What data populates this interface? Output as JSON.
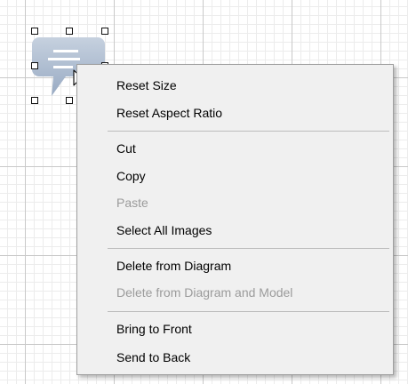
{
  "menu": {
    "items": [
      {
        "label": "Reset Size",
        "enabled": true
      },
      {
        "label": "Reset Aspect Ratio",
        "enabled": true
      },
      {
        "label": "Cut",
        "enabled": true
      },
      {
        "label": "Copy",
        "enabled": true
      },
      {
        "label": "Paste",
        "enabled": false
      },
      {
        "label": "Select All Images",
        "enabled": true
      },
      {
        "label": "Delete from Diagram",
        "enabled": true
      },
      {
        "label": "Delete from Diagram and Model",
        "enabled": false
      },
      {
        "label": "Bring to Front",
        "enabled": true
      },
      {
        "label": "Send to Back",
        "enabled": true
      }
    ]
  },
  "colors": {
    "menu_background": "#f0f0f0",
    "menu_border": "#a0a0a0",
    "disabled_text": "#9b9b9b",
    "bubble_fill": "#a9b9cf",
    "grid_major": "#c9c9c9",
    "grid_minor": "#ececec"
  },
  "icons": {
    "shape": "speech-bubble-icon",
    "pointer": "mouse-cursor-icon"
  }
}
